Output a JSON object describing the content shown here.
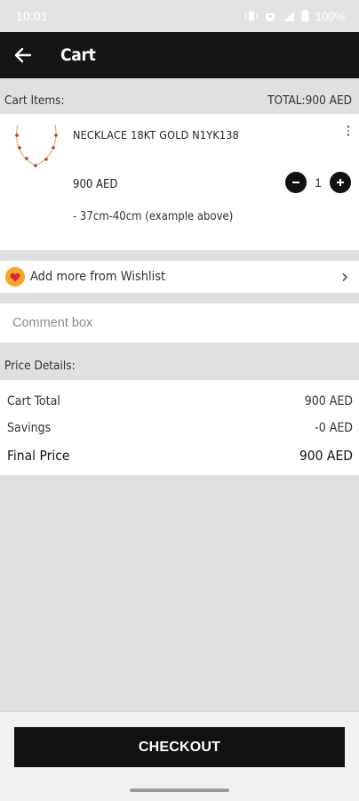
{
  "status_bar": {
    "time": "10:01",
    "battery": "100%",
    "icons": [
      "vibrate-icon",
      "hotspot-icon",
      "signal-icon",
      "battery-icon"
    ]
  },
  "app_bar": {
    "title": "Cart",
    "back_icon": "arrow-left-icon"
  },
  "cart": {
    "header_label": "Cart Items:",
    "total_label": "TOTAL:900 AED",
    "items": [
      {
        "name": "NECKLACE 18KT GOLD N1YK138",
        "price": "900 AED",
        "quantity": "1",
        "variant": "- 37cm-40cm (example above)",
        "image": "gold-necklace-image"
      }
    ]
  },
  "wishlist": {
    "label": "Add more from Wishlist",
    "icon": "heart-icon"
  },
  "comment": {
    "placeholder": "Comment box",
    "value": ""
  },
  "price_details": {
    "header_label": "Price Details:",
    "cart_total_label": "Cart Total",
    "cart_total_value": "900 AED",
    "savings_label": "Savings",
    "savings_value": "-0 AED",
    "final_label": "Final Price",
    "final_value": "900 AED"
  },
  "checkout": {
    "label": "CHECKOUT"
  },
  "colors": {
    "app_bar": "#151515",
    "background": "#e0e0e0",
    "button": "#111111",
    "heart_badge": "#f5a623",
    "heart": "#d9253c"
  }
}
